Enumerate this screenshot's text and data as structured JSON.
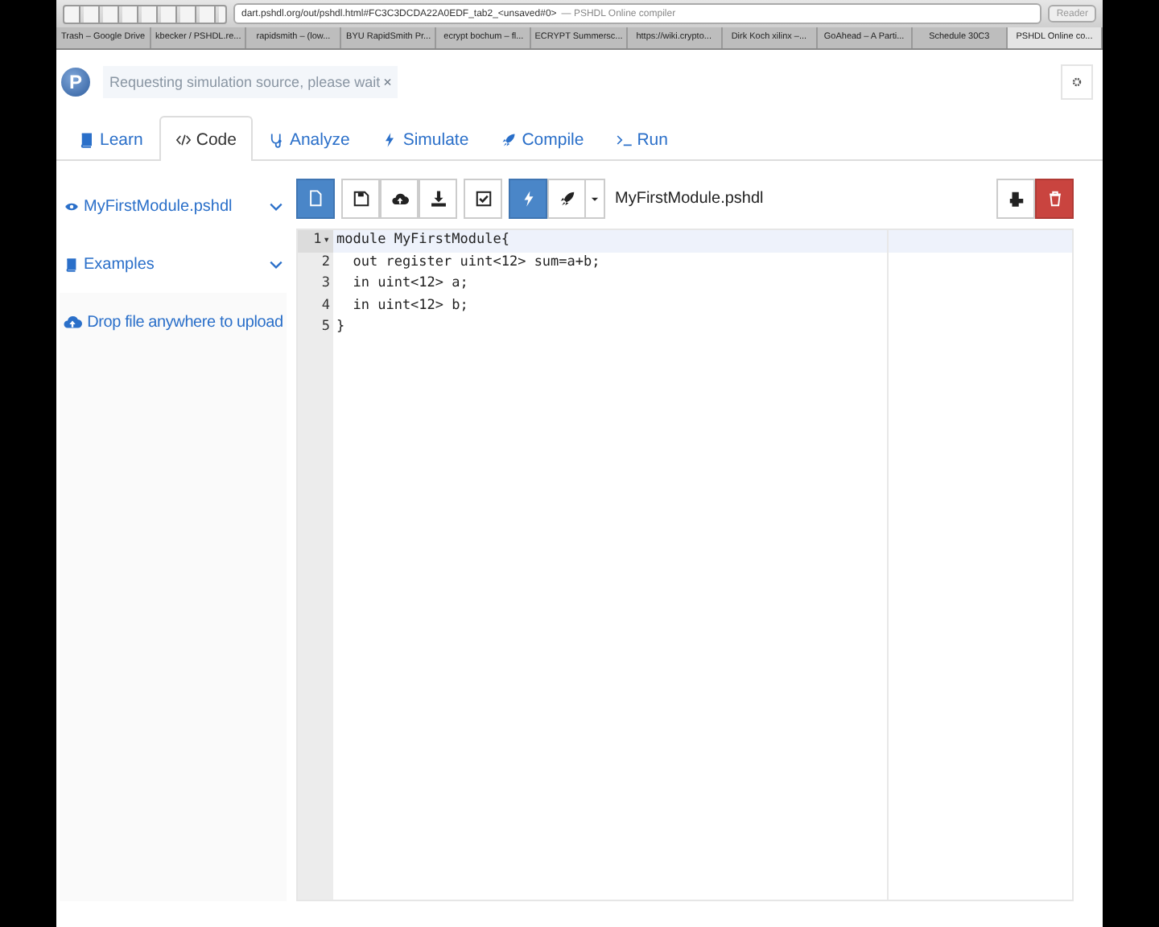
{
  "browser": {
    "url": "dart.pshdl.org/out/pshdl.html#FC3C3DCDA22A0EDF_tab2_<unsaved#0>",
    "title": "— PSHDL Online compiler",
    "reader": "Reader",
    "tabs": [
      {
        "label": "Trash – Google Drive",
        "selected": false
      },
      {
        "label": "kbecker / PSHDL.re...",
        "selected": false
      },
      {
        "label": "rapidsmith – (low...",
        "selected": false
      },
      {
        "label": "BYU RapidSmith Pr...",
        "selected": false
      },
      {
        "label": "ecrypt bochum – fl...",
        "selected": false
      },
      {
        "label": "ECRYPT Summersc...",
        "selected": false
      },
      {
        "label": "https://wiki.crypto...",
        "selected": false
      },
      {
        "label": "Dirk Koch xilinx –...",
        "selected": false
      },
      {
        "label": "GoAhead – A Parti...",
        "selected": false
      },
      {
        "label": "Schedule 30C3",
        "selected": false
      },
      {
        "label": "PSHDL Online co...",
        "selected": true
      }
    ]
  },
  "header": {
    "logo": "P",
    "notification": "Requesting simulation source, please wait",
    "close": "×"
  },
  "nav_tabs": [
    {
      "kind": "learn",
      "label": "Learn",
      "selected": false
    },
    {
      "kind": "code",
      "label": "Code",
      "selected": true
    },
    {
      "kind": "analyze",
      "label": "Analyze",
      "selected": false
    },
    {
      "kind": "simulate",
      "label": "Simulate",
      "selected": false
    },
    {
      "kind": "compile",
      "label": "Compile",
      "selected": false
    },
    {
      "kind": "run",
      "label": "Run",
      "selected": false
    }
  ],
  "sidebar": {
    "file": "MyFirstModule.pshdl",
    "examples": "Examples",
    "upload": "Drop file anywhere to upload"
  },
  "toolbar": [
    {
      "kind": "new",
      "selected": true
    },
    {
      "kind": "save",
      "selected": false
    },
    {
      "kind": "upload",
      "selected": false
    },
    {
      "kind": "download",
      "selected": false
    },
    {
      "kind": "check",
      "selected": false
    },
    {
      "kind": "bolt",
      "selected": true
    },
    {
      "kind": "rocket",
      "selected": false
    },
    {
      "kind": "caret",
      "selected": false
    }
  ],
  "file_name": "MyFirstModule.pshdl",
  "editor": {
    "lines": [
      {
        "number": "1",
        "fold": "▾",
        "code": "module MyFirstModule{"
      },
      {
        "number": "2",
        "code": "  out register uint<12> sum=a+b;"
      },
      {
        "number": "3",
        "code": "  in uint<12> a;"
      },
      {
        "number": "4",
        "code": "  in uint<12> b;"
      },
      {
        "number": "5",
        "code": "}"
      }
    ]
  }
}
